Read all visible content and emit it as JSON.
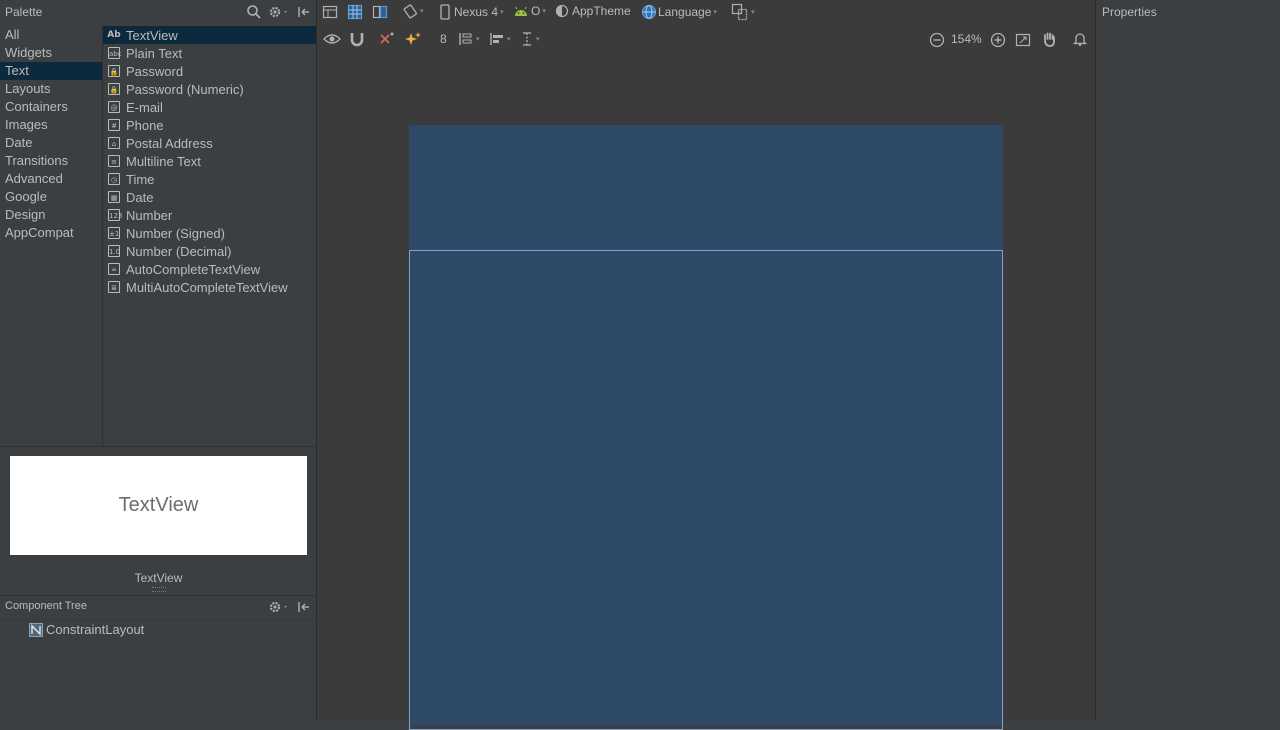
{
  "palette": {
    "title": "Palette",
    "categories": [
      {
        "label": "All"
      },
      {
        "label": "Widgets"
      },
      {
        "label": "Text",
        "selected": true
      },
      {
        "label": "Layouts"
      },
      {
        "label": "Containers"
      },
      {
        "label": "Images"
      },
      {
        "label": "Date"
      },
      {
        "label": "Transitions"
      },
      {
        "label": "Advanced"
      },
      {
        "label": "Google"
      },
      {
        "label": "Design"
      },
      {
        "label": "AppCompat"
      }
    ],
    "items": [
      {
        "label": "TextView",
        "icon": "textview-icon",
        "icon_text": "Ab",
        "selected": true
      },
      {
        "label": "Plain Text",
        "icon": "plain-text-icon",
        "icon_text": "abc"
      },
      {
        "label": "Password",
        "icon": "lock-icon",
        "icon_text": "🔒"
      },
      {
        "label": "Password (Numeric)",
        "icon": "lock-numeric-icon",
        "icon_text": "🔒"
      },
      {
        "label": "E-mail",
        "icon": "at-icon",
        "icon_text": "@"
      },
      {
        "label": "Phone",
        "icon": "hash-icon",
        "icon_text": "#"
      },
      {
        "label": "Postal Address",
        "icon": "home-icon",
        "icon_text": "⌂"
      },
      {
        "label": "Multiline Text",
        "icon": "multiline-icon",
        "icon_text": "≡"
      },
      {
        "label": "Time",
        "icon": "clock-icon",
        "icon_text": "◷"
      },
      {
        "label": "Date",
        "icon": "calendar-icon",
        "icon_text": "▦"
      },
      {
        "label": "Number",
        "icon": "number-icon",
        "icon_text": "123"
      },
      {
        "label": "Number (Signed)",
        "icon": "number-signed-icon",
        "icon_text": "±1"
      },
      {
        "label": "Number (Decimal)",
        "icon": "number-decimal-icon",
        "icon_text": "1.0"
      },
      {
        "label": "AutoCompleteTextView",
        "icon": "autocomplete-icon",
        "icon_text": "≐"
      },
      {
        "label": "MultiAutoCompleteTextView",
        "icon": "multiautocomplete-icon",
        "icon_text": "≣"
      }
    ],
    "preview_text": "TextView",
    "preview_caption": "TextView"
  },
  "component_tree": {
    "title": "Component Tree",
    "root": "ConstraintLayout"
  },
  "toolbar": {
    "device": "Nexus 4",
    "api": "O",
    "theme": "AppTheme",
    "language": "Language",
    "margin": "8",
    "zoom": "154%"
  },
  "properties": {
    "title": "Properties"
  },
  "colors": {
    "panel_bg": "#3c3f41",
    "selection": "#0d293e",
    "canvas_blue": "#2e4a68",
    "accent_blue": "#4a88c7"
  }
}
